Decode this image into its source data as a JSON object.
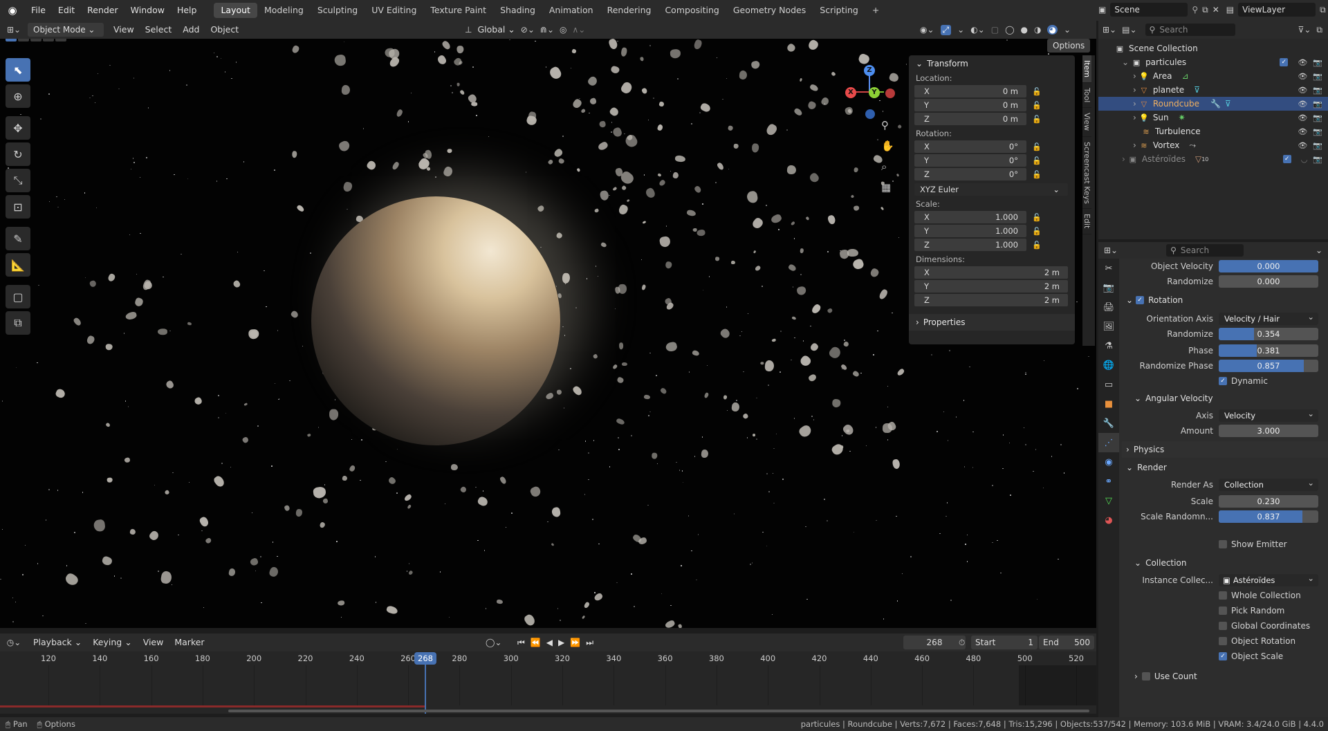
{
  "menu": [
    "File",
    "Edit",
    "Render",
    "Window",
    "Help"
  ],
  "workspaces": [
    "Layout",
    "Modeling",
    "Sculpting",
    "UV Editing",
    "Texture Paint",
    "Shading",
    "Animation",
    "Rendering",
    "Compositing",
    "Geometry Nodes",
    "Scripting"
  ],
  "active_workspace": "Layout",
  "scene": "Scene",
  "view_layer": "ViewLayer",
  "viewport_header": {
    "mode": "Object Mode",
    "menus": [
      "View",
      "Select",
      "Add",
      "Object"
    ],
    "orientation": "Global",
    "options": "Options"
  },
  "gizmo": {
    "x": "X",
    "y": "Y",
    "z": "Z"
  },
  "npanel": {
    "title": "Transform",
    "location_label": "Location:",
    "location": [
      {
        "axis": "X",
        "value": "0 m"
      },
      {
        "axis": "Y",
        "value": "0 m"
      },
      {
        "axis": "Z",
        "value": "0 m"
      }
    ],
    "rotation_label": "Rotation:",
    "rotation": [
      {
        "axis": "X",
        "value": "0°"
      },
      {
        "axis": "Y",
        "value": "0°"
      },
      {
        "axis": "Z",
        "value": "0°"
      }
    ],
    "rotation_mode": "XYZ Euler",
    "scale_label": "Scale:",
    "scale": [
      {
        "axis": "X",
        "value": "1.000"
      },
      {
        "axis": "Y",
        "value": "1.000"
      },
      {
        "axis": "Z",
        "value": "1.000"
      }
    ],
    "dimensions_label": "Dimensions:",
    "dimensions": [
      {
        "axis": "X",
        "value": "2 m"
      },
      {
        "axis": "Y",
        "value": "2 m"
      },
      {
        "axis": "Z",
        "value": "2 m"
      }
    ],
    "properties": "Properties",
    "tabs": [
      "Item",
      "Tool",
      "View",
      "Screencast Keys",
      "Edit"
    ]
  },
  "outliner": {
    "search_placeholder": "Search",
    "root": "Scene Collection",
    "collection": "particules",
    "items": [
      {
        "name": "Area",
        "icon": "light-icon"
      },
      {
        "name": "planete",
        "icon": "mesh-icon"
      },
      {
        "name": "Roundcube",
        "icon": "mesh-icon",
        "selected": true
      },
      {
        "name": "Sun",
        "icon": "light-icon"
      },
      {
        "name": "Turbulence",
        "icon": "force-icon"
      },
      {
        "name": "Vortex",
        "icon": "force-icon"
      }
    ],
    "collection2": "Astéroïdes",
    "collection2_badge": "10"
  },
  "properties": {
    "search_placeholder": "Search",
    "object_velocity_label": "Object Velocity",
    "object_velocity": "0.000",
    "randomize_label": "Randomize",
    "randomize": "0.000",
    "rotation_section": "Rotation",
    "orientation_axis_label": "Orientation Axis",
    "orientation_axis": "Velocity / Hair",
    "rot_randomize_label": "Randomize",
    "rot_randomize": "0.354",
    "rot_randomize_frac": 0.354,
    "phase_label": "Phase",
    "phase": "0.381",
    "phase_frac": 0.381,
    "randomize_phase_label": "Randomize Phase",
    "randomize_phase": "0.857",
    "randomize_phase_frac": 0.857,
    "dynamic_label": "Dynamic",
    "angular_velocity_section": "Angular Velocity",
    "axis_label": "Axis",
    "axis": "Velocity",
    "amount_label": "Amount",
    "amount": "3.000",
    "physics_section": "Physics",
    "render_section": "Render",
    "render_as_label": "Render As",
    "render_as": "Collection",
    "scale_label": "Scale",
    "scale": "0.230",
    "scale_random_label": "Scale Randomn...",
    "scale_random": "0.837",
    "scale_random_frac": 0.837,
    "show_emitter": "Show Emitter",
    "collection_section": "Collection",
    "instance_collection_label": "Instance Collec...",
    "instance_collection": "Astéroïdes",
    "whole_collection": "Whole Collection",
    "pick_random": "Pick Random",
    "global_coordinates": "Global Coordinates",
    "object_rotation": "Object Rotation",
    "object_scale": "Object Scale",
    "use_count": "Use Count"
  },
  "timeline": {
    "menus": [
      "Playback",
      "Keying",
      "View",
      "Marker"
    ],
    "current_frame": "268",
    "start_label": "Start",
    "start": "1",
    "end_label": "End",
    "end": "500",
    "ticks": [
      "120",
      "140",
      "160",
      "180",
      "200",
      "220",
      "240",
      "260",
      "280",
      "300",
      "320",
      "340",
      "360",
      "380",
      "400",
      "420",
      "440",
      "460",
      "480",
      "500",
      "520"
    ]
  },
  "status": {
    "left1": "Pan",
    "left2": "Options",
    "right": "particules | Roundcube | Verts:7,672 | Faces:7,648 | Tris:15,296 | Objects:537/542 | Memory: 103.6 MiB | VRAM: 3.4/24.0 GiB | 4.4.0"
  },
  "colors": {
    "accent": "#4772b3",
    "selected_row": "#334d80",
    "bg": "#1d1d1d"
  }
}
